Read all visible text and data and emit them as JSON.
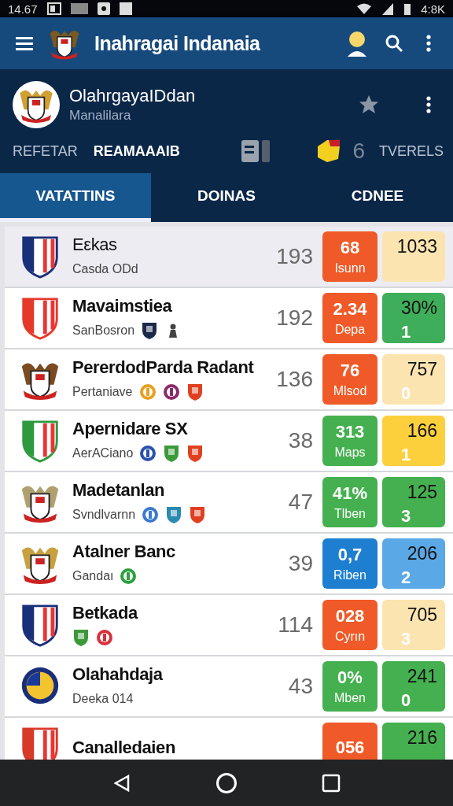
{
  "status_bar": {
    "time": "14.67",
    "right_text": "4:8K"
  },
  "app_bar": {
    "title": "Inahragai Indanaia"
  },
  "profile": {
    "name": "OlahrgayaIDdan",
    "subtitle": "Manalilara",
    "links": [
      {
        "label": "REFETAR",
        "selected": false
      },
      {
        "label": "REAMAAAIB",
        "selected": true
      }
    ],
    "count": "6",
    "right_label": "TVERELS"
  },
  "tabs": [
    {
      "label": "VATATTINS",
      "selected": true
    },
    {
      "label": "DOINAS",
      "selected": false
    },
    {
      "label": "CDNEE",
      "selected": false
    }
  ],
  "rows": [
    {
      "name": "Eεkas",
      "subtitle": "Casda ODd",
      "rank": "193",
      "selected": true,
      "crest": {
        "kind": "shield",
        "color": "#1a2f7a"
      },
      "emblems": [],
      "badge": {
        "value": "68",
        "label": "Isunn",
        "color": "#f05a28"
      },
      "score": {
        "value": "1033",
        "color": "#fbe4b0"
      }
    },
    {
      "name": "Mavaimstiea",
      "subtitle": "SanBosron",
      "rank": "192",
      "selected": false,
      "crest": {
        "kind": "shield",
        "color": "#e53a2a"
      },
      "emblems": [
        {
          "kind": "shield",
          "color": "#1b2a4a"
        },
        {
          "kind": "pawn",
          "color": "#444444"
        }
      ],
      "badge": {
        "value": "2.34",
        "label": "Depa",
        "color": "#f05a28"
      },
      "score": {
        "value": "30%",
        "sub": "1",
        "color": "#3fae5a"
      }
    },
    {
      "name": "PererdodParda Radant",
      "subtitle": "Pertaniave",
      "rank": "136",
      "selected": false,
      "crest": {
        "kind": "eagle",
        "color": "#7a4a20"
      },
      "emblems": [
        {
          "kind": "circle",
          "color": "#e8a020"
        },
        {
          "kind": "circle",
          "color": "#8a2a6a"
        },
        {
          "kind": "shield",
          "color": "#e04020"
        }
      ],
      "badge": {
        "value": "76",
        "label": "Mlsod",
        "color": "#f05a28"
      },
      "score": {
        "value": "757",
        "sub": "0",
        "color": "#fbe4b0"
      }
    },
    {
      "name": "Apernidare SX",
      "subtitle": "AerACiano",
      "rank": "38",
      "selected": false,
      "crest": {
        "kind": "shield",
        "color": "#2e9a3e"
      },
      "emblems": [
        {
          "kind": "circle",
          "color": "#2a50b0"
        },
        {
          "kind": "shield",
          "color": "#3a9a3a"
        },
        {
          "kind": "shield",
          "color": "#e04020"
        }
      ],
      "badge": {
        "value": "313",
        "label": "Maps",
        "color": "#45b04f"
      },
      "score": {
        "value": "166",
        "sub": "1",
        "color": "#fcd03c"
      }
    },
    {
      "name": "Madetanlan",
      "subtitle": "Svndlvarnn",
      "rank": "47",
      "selected": false,
      "crest": {
        "kind": "eagle",
        "color": "#b0a070"
      },
      "emblems": [
        {
          "kind": "circle",
          "color": "#3a7ad0"
        },
        {
          "kind": "shield",
          "color": "#2a8ab0"
        },
        {
          "kind": "shield",
          "color": "#e04020"
        }
      ],
      "badge": {
        "value": "41%",
        "label": "Tlben",
        "color": "#45b04f"
      },
      "score": {
        "value": "125",
        "sub": "3",
        "color": "#45b04f"
      }
    },
    {
      "name": "Atalner Banc",
      "subtitle": "Gandaı",
      "rank": "39",
      "selected": false,
      "crest": {
        "kind": "eagle",
        "color": "#c8a040"
      },
      "emblems": [
        {
          "kind": "circle",
          "color": "#2ea040"
        }
      ],
      "badge": {
        "value": "0,7",
        "label": "Riben",
        "color": "#1e7fd0"
      },
      "score": {
        "value": "206",
        "sub": "2",
        "color": "#5aa8e6"
      }
    },
    {
      "name": "Betkada",
      "rank": "114",
      "selected": false,
      "crest": {
        "kind": "shield",
        "color": "#1a2f7a"
      },
      "emblems": [
        {
          "kind": "shield",
          "color": "#3a9a3a"
        },
        {
          "kind": "circle",
          "color": "#d8303a"
        }
      ],
      "badge": {
        "value": "028",
        "label": "Cyrın",
        "color": "#f05a28"
      },
      "score": {
        "value": "705",
        "sub": "3",
        "color": "#fbe4b0"
      }
    },
    {
      "name": "Olahahdaja",
      "subtitle": "Deeka 014",
      "rank": "43",
      "selected": false,
      "crest": {
        "kind": "circle",
        "color": "#1a2f7a"
      },
      "emblems": [],
      "badge": {
        "value": "0%",
        "label": "Mben",
        "color": "#45b04f"
      },
      "score": {
        "value": "241",
        "sub": "0",
        "color": "#45b04f"
      }
    },
    {
      "name": "Canalledaien",
      "selected": false,
      "crest": {
        "kind": "shield",
        "color": "#d83a2a"
      },
      "emblems": [],
      "badge": {
        "value": "056",
        "color": "#f05a28"
      },
      "score": {
        "value": "216",
        "color": "#45b04f"
      }
    }
  ]
}
